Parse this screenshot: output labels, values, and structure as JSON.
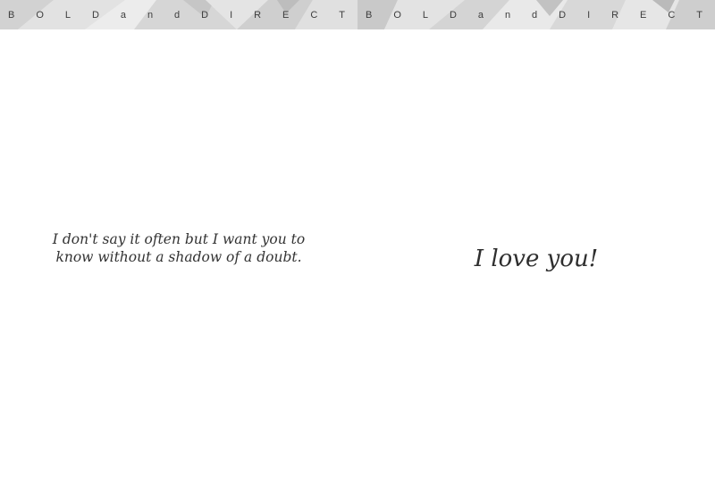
{
  "card": {
    "left_panel": {
      "header_letters": [
        "B",
        "O",
        "L",
        "D",
        "a",
        "n",
        "d",
        "D",
        "I",
        "R",
        "E",
        "C",
        "T"
      ],
      "message": "I don't say it often but I want you to know without a shadow of a doubt."
    },
    "right_panel": {
      "header_letters": [
        "B",
        "O",
        "L",
        "D",
        "a",
        "n",
        "d",
        "D",
        "I",
        "R",
        "E",
        "C",
        "T"
      ],
      "message": "I love you!"
    },
    "colors": {
      "band_light": "#e6e6e6",
      "band_dark": "#c8c8c8",
      "text": "#333333"
    }
  }
}
